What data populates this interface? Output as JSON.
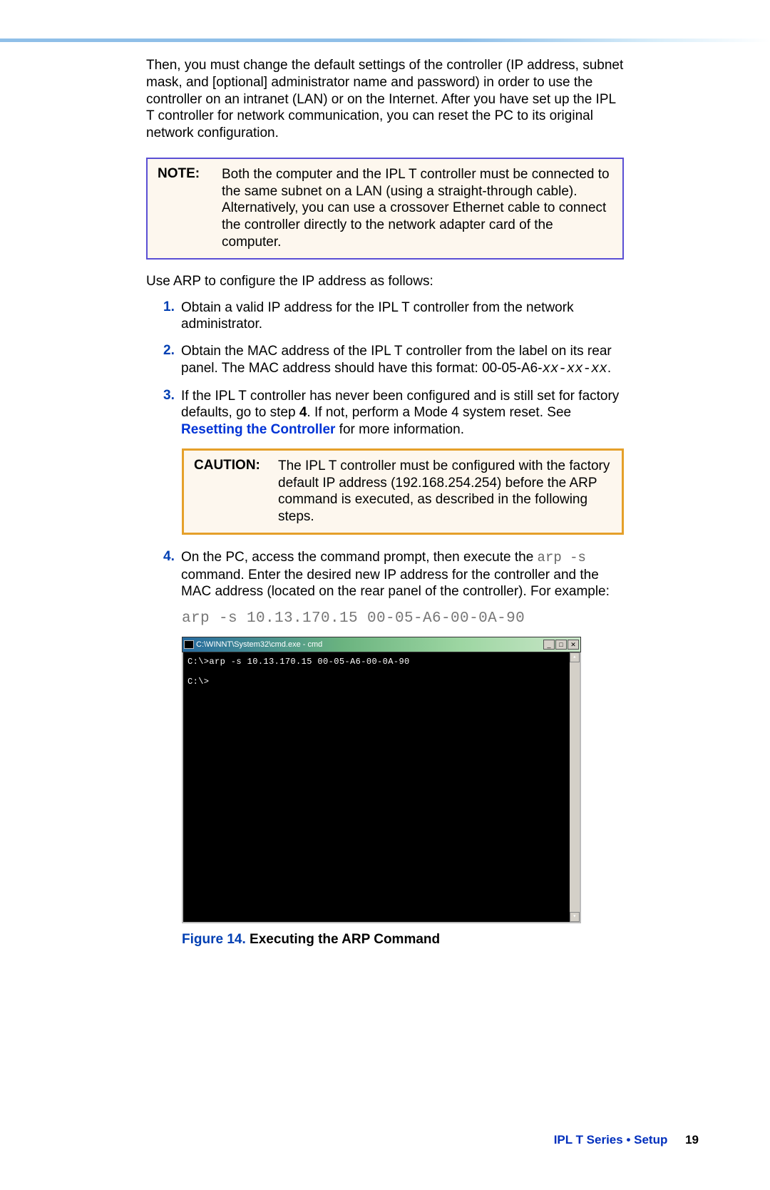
{
  "intro": "Then, you must change the default settings of the controller (IP address, subnet mask, and [optional] administrator name and password) in order to use the controller on an intranet (LAN) or on the Internet. After you have set up the IPL T controller for network communication, you can reset the PC to its original network configuration.",
  "note": {
    "label": "NOTE:",
    "text": "Both the computer and the IPL T controller must be connected to the same subnet on a LAN (using a straight-through cable). Alternatively, you can use a crossover Ethernet cable to connect the controller directly to the network adapter card of the computer."
  },
  "lead_in": "Use ARP to configure the IP address as follows:",
  "steps": {
    "s1": {
      "num": "1.",
      "text": "Obtain a valid IP address for the IPL T controller from the network administrator."
    },
    "s2": {
      "num": "2.",
      "text_a": "Obtain the MAC address of the IPL T controller from the label on its rear panel. The MAC address should have this format: 00-05-A6-",
      "mac_var": "xx-xx-xx",
      "text_b": "."
    },
    "s3": {
      "num": "3.",
      "text_a": "If the IPL T controller has never been configured and is still set for factory defaults, go to step ",
      "step_ref": "4",
      "text_b": ". If not, perform a Mode 4 system reset. See ",
      "link": "Resetting the Controller",
      "text_c": " for more information."
    },
    "s4": {
      "num": "4.",
      "text_a": "On the PC, access the command prompt, then execute the ",
      "cmd": "arp -s",
      "text_b": " command. Enter the desired new IP address for the controller and the MAC address (located on the rear panel of the controller). For example:"
    }
  },
  "caution": {
    "label": "CAUTION:",
    "text": "The IPL T controller must be configured with the factory default IP address (192.168.254.254) before the ARP command is executed, as described in the following steps."
  },
  "code_example": "arp -s 10.13.170.15 00-05-A6-00-0A-90",
  "terminal": {
    "title": "C:\\WINNT\\System32\\cmd.exe - cmd",
    "line1": "C:\\>arp -s 10.13.170.15 00-05-A6-00-0A-90",
    "line2": "C:\\>"
  },
  "figure": {
    "num": "Figure 14.",
    "title": " Executing the ARP Command"
  },
  "footer": {
    "text": "IPL T Series • Setup",
    "page": "19"
  }
}
